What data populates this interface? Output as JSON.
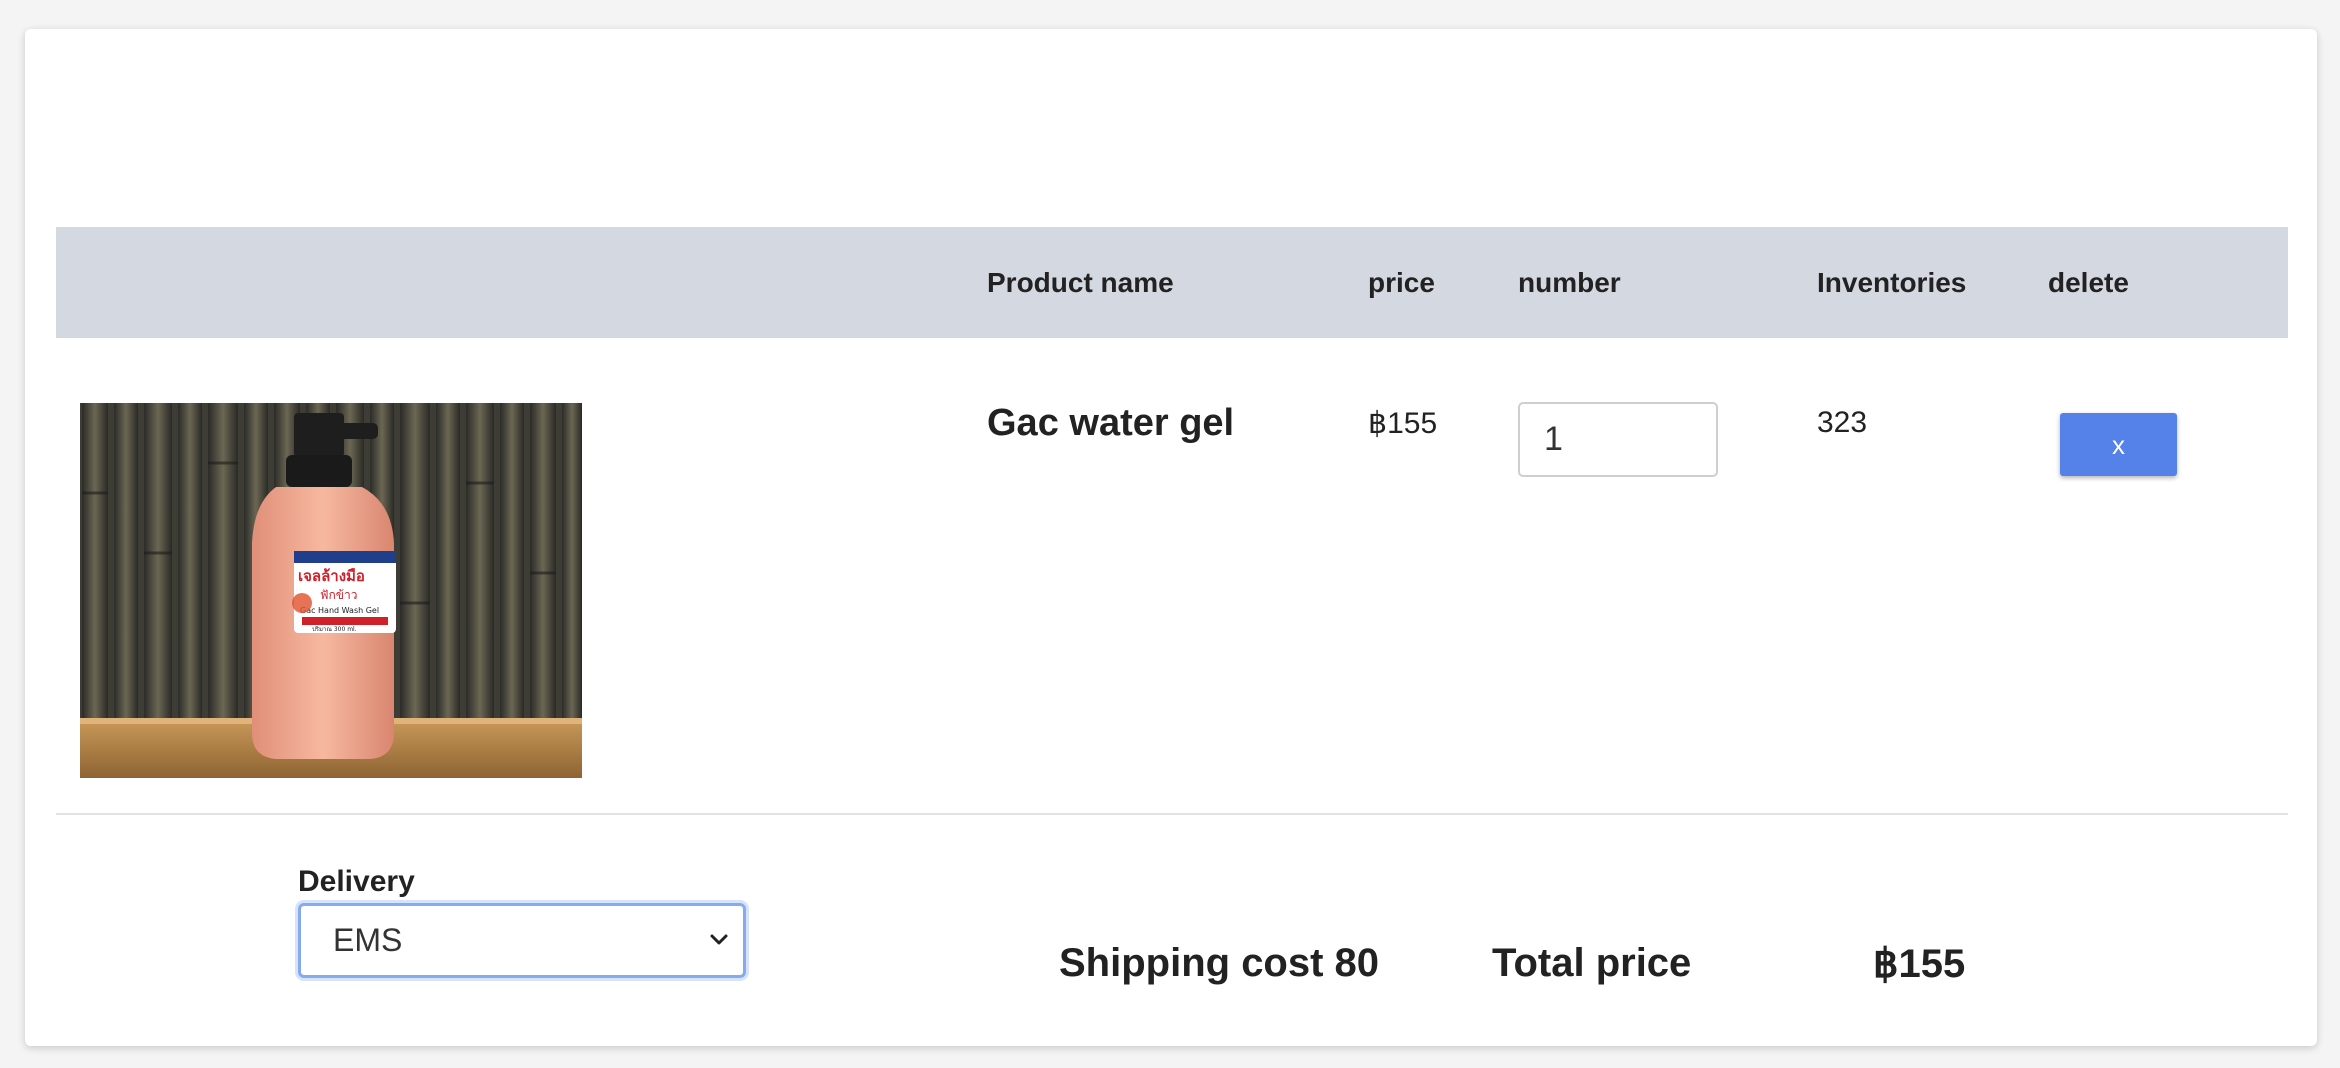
{
  "table": {
    "headers": {
      "product_name": "Product name",
      "price": "price",
      "number": "number",
      "inventories": "Inventories",
      "delete": "delete"
    },
    "rows": [
      {
        "image_alt": "Gac hand wash gel bottle",
        "product_name": "Gac water gel",
        "price": "฿155",
        "quantity": "1",
        "inventory": "323",
        "delete_label": "x"
      }
    ]
  },
  "delivery": {
    "label": "Delivery",
    "selected": "EMS"
  },
  "summary": {
    "shipping": "Shipping cost 80",
    "total_label": "Total price",
    "total_value": "฿155"
  },
  "product_label": {
    "thai_title": "เจลล้างมือ",
    "thai_sub": "ฟักข้าว",
    "english": "Gac Hand Wash Gel",
    "volume": "ปริมาณ 300 ml."
  },
  "colors": {
    "header_bg": "#d4d8e1",
    "button_bg": "#5482e8",
    "select_border": "#86aaf0"
  }
}
